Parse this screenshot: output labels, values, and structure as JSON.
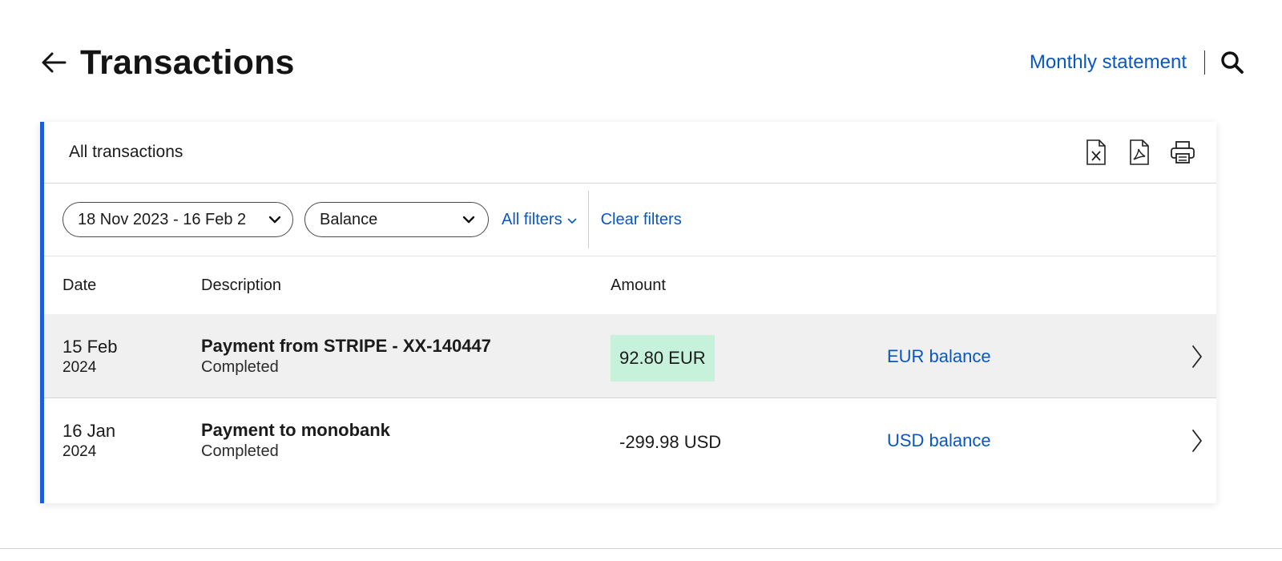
{
  "header": {
    "title": "Transactions",
    "monthly_statement": "Monthly statement"
  },
  "card": {
    "title": "All transactions",
    "actions": [
      "excel-export-icon",
      "pdf-export-icon",
      "print-icon"
    ],
    "accent_color": "#1a5fd6"
  },
  "filters": {
    "date_range": "18 Nov 2023 - 16 Feb 2",
    "balance": "Balance",
    "all_filters": "All filters",
    "clear_filters": "Clear filters"
  },
  "table": {
    "columns": [
      "Date",
      "Description",
      "Amount"
    ],
    "rows": [
      {
        "date_day": "15 Feb",
        "date_year": "2024",
        "title": "Payment from STRIPE - XX-140447",
        "status": "Completed",
        "amount": "92.80 EUR",
        "amount_type": "incoming",
        "balance": "EUR balance"
      },
      {
        "date_day": "16 Jan",
        "date_year": "2024",
        "title": "Payment to monobank",
        "status": "Completed",
        "amount": "-299.98 USD",
        "amount_type": "outgoing",
        "balance": "USD balance"
      }
    ]
  },
  "colors": {
    "link": "#0a57c2",
    "incoming_highlight": "#c6f2dc",
    "selected_row": "#f0f0f1"
  }
}
